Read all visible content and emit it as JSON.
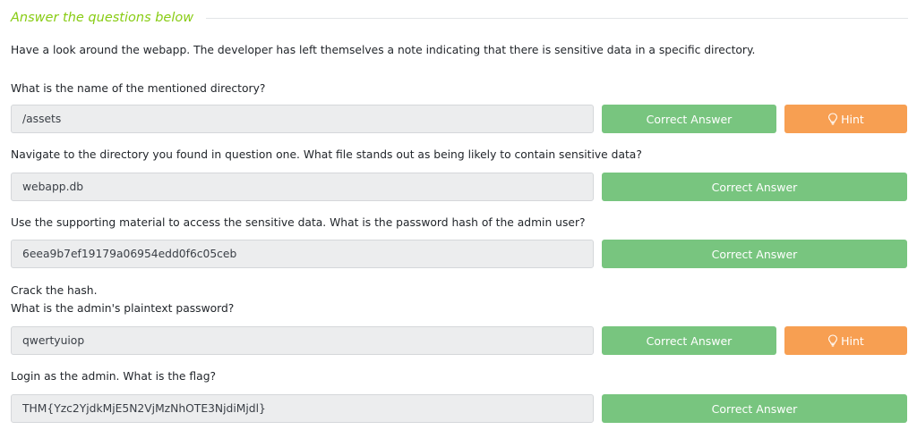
{
  "section": {
    "title": "Answer the questions below"
  },
  "intro": "Have a look around the webapp. The developer has left themselves a note indicating that there is sensitive data in a specific directory.",
  "questions": [
    {
      "text": [
        "What is the name of the mentioned directory?"
      ],
      "answer": "/assets",
      "button": "Correct Answer",
      "hint": "Hint"
    },
    {
      "text": [
        "Navigate to the directory you found in question one. What file stands out as being likely to contain sensitive data?"
      ],
      "answer": "webapp.db",
      "button": "Correct Answer"
    },
    {
      "text": [
        "Use the supporting material to access the sensitive data. What is the password hash of the admin user?"
      ],
      "answer": "6eea9b7ef19179a06954edd0f6c05ceb",
      "button": "Correct Answer"
    },
    {
      "text": [
        "Crack the hash.",
        "What is the admin's plaintext password?"
      ],
      "answer": "qwertyuiop",
      "button": "Correct Answer",
      "hint": "Hint"
    },
    {
      "text": [
        "Login as the admin. What is the flag?"
      ],
      "answer": "THM{Yzc2YjdkMjE5N2VjMzNhOTE3NjdiMjdl}",
      "button": "Correct Answer"
    }
  ],
  "colors": {
    "accent": "#88cc14",
    "correct": "#78c57f",
    "hint": "#f79f52",
    "field_bg": "#ecedee"
  },
  "icons": {
    "hint": "lightbulb-icon"
  }
}
